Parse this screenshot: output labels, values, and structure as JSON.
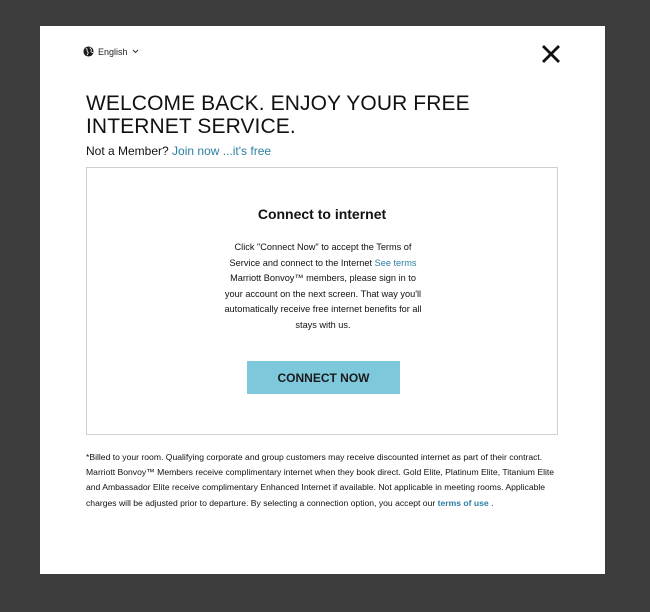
{
  "language": {
    "label": "English",
    "globe_icon": "globe-icon",
    "chevron_icon": "chevron-down-icon"
  },
  "close_icon": "close-icon",
  "headline": "WELCOME BACK. ENJOY YOUR FREE INTERNET SERVICE.",
  "member": {
    "prompt": "Not a Member?",
    "join_link": "Join now ...it's free"
  },
  "card": {
    "title": "Connect to internet",
    "body_part1": "Click \"Connect Now\" to accept the Terms of Service and connect to the Internet ",
    "see_terms_link": "See terms",
    "body_part2": " Marriott Bonvoy™ members, please sign in to your account on the next screen. That way you'll automatically receive free internet benefits for all stays with us.",
    "button_label": "CONNECT NOW",
    "button_color": "#7ec8dc"
  },
  "fineprint": {
    "text": "*Billed to your room. Qualifying corporate and group customers may receive discounted internet as part of their contract. Marriott Bonvoy™ Members receive complimentary internet when they book direct. Gold Elite, Platinum Elite, Titanium Elite and Ambassador Elite receive complimentary Enhanced Internet if available. Not applicable in meeting rooms. Applicable charges will be adjusted prior to departure. By selecting a connection option, you accept our ",
    "terms_link": "terms of use",
    "end": " ."
  },
  "colors": {
    "backdrop": "#3c3c3c",
    "link": "#2b7fa3"
  }
}
